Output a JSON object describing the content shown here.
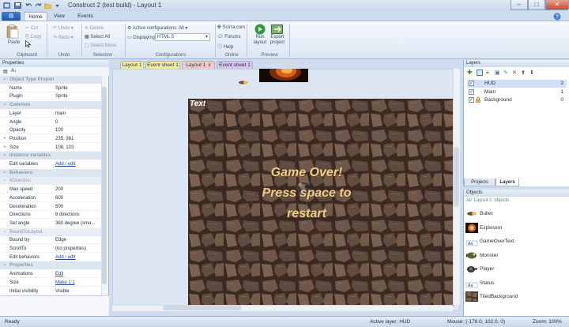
{
  "window": {
    "title": "Construct 2 (test build) - Layout 1",
    "app_menu_label": "▤"
  },
  "ribbon_tabs": [
    "Home",
    "View",
    "Events"
  ],
  "ribbon": {
    "clipboard": {
      "paste": "Paste",
      "cut": "Cut",
      "copy": "Copy",
      "group": "Clipboard"
    },
    "undo": {
      "undo": "Undo",
      "redo": "Redo",
      "group": "Undo"
    },
    "selection": {
      "delete": "Delete",
      "select_all": "Select All",
      "select_none": "Select None",
      "group": "Selection"
    },
    "configurations": {
      "active": "Active configurations: All",
      "displaying_label": "Displaying:",
      "displaying_value": "HTML 5",
      "group": "Configurations"
    },
    "online": {
      "scirra": "Scirra.com",
      "forums": "Forums",
      "help": "Help",
      "group": "Online"
    },
    "preview": {
      "run": "Run layout",
      "export": "Export project",
      "group": "Preview"
    }
  },
  "properties": {
    "header": "Properties",
    "rows": [
      {
        "kind": "cat",
        "key": "Object Type Properties"
      },
      {
        "kind": "row",
        "key": "Name",
        "value": "Sprite"
      },
      {
        "kind": "row",
        "key": "Plugin",
        "value": "Sprite"
      },
      {
        "kind": "cat",
        "key": "Common"
      },
      {
        "kind": "row",
        "key": "Layer",
        "value": "main"
      },
      {
        "kind": "row",
        "key": "Angle",
        "value": "0"
      },
      {
        "kind": "row",
        "key": "Opacity",
        "value": "100"
      },
      {
        "kind": "row",
        "key": "Position",
        "value": "235, 361",
        "expand": "+"
      },
      {
        "kind": "row",
        "key": "Size",
        "value": "108, 103",
        "expand": "+"
      },
      {
        "kind": "cat",
        "key": "Instance variables"
      },
      {
        "kind": "row",
        "key": "Edit variables",
        "value": "Add / edit",
        "link": true
      },
      {
        "kind": "cat",
        "key": "Behaviors"
      },
      {
        "kind": "sub",
        "key": "8Direction",
        "expand": "−"
      },
      {
        "kind": "row",
        "key": "Max speed",
        "value": "200"
      },
      {
        "kind": "row",
        "key": "Acceleration",
        "value": "600"
      },
      {
        "kind": "row",
        "key": "Deceleration",
        "value": "500"
      },
      {
        "kind": "row",
        "key": "Directions",
        "value": "8 directions"
      },
      {
        "kind": "row",
        "key": "Set angle",
        "value": "360 degree (smo..."
      },
      {
        "kind": "sub",
        "key": "BoundToLayout",
        "expand": "−"
      },
      {
        "kind": "row",
        "key": "Bound by",
        "value": "Edge"
      },
      {
        "kind": "row",
        "key": "ScrollTo",
        "value": "(no properties)"
      },
      {
        "kind": "row",
        "key": "Edit behaviors",
        "value": "Add / edit",
        "link": true
      },
      {
        "kind": "cat",
        "key": "Properties"
      },
      {
        "kind": "row",
        "key": "Animations",
        "value": "Edit",
        "link": true
      },
      {
        "kind": "row",
        "key": "Size",
        "value": "Make 1:1",
        "link": true
      },
      {
        "kind": "row",
        "key": "Initial visibility",
        "value": "Visible"
      }
    ]
  },
  "doc_tabs": [
    {
      "label": "Layout 1",
      "color": "#f3e9a6"
    },
    {
      "label": "Event sheet 1",
      "color": "#f3e9a6"
    },
    {
      "label": "Layout 1",
      "color": "#f2c9c9",
      "active": true,
      "close": "x"
    },
    {
      "label": "Event sheet 1",
      "color": "#d8c4ee"
    }
  ],
  "layout": {
    "text_object": "Text",
    "game_over_text": "Game Over!\nPress space to\nrestart"
  },
  "layers": {
    "header": "Layers",
    "rows": [
      {
        "name": "HUD",
        "num": "2",
        "selected": true
      },
      {
        "name": "Main",
        "num": "1"
      },
      {
        "name": "Background",
        "num": "0",
        "locked": true
      }
    ],
    "tabs": [
      "Projects",
      "Layers"
    ]
  },
  "objects": {
    "header": "Objects",
    "filter": "All 'Layout 1' objects",
    "items": [
      {
        "name": "Bullet",
        "icon": "bullet-icon"
      },
      {
        "name": "Explosion",
        "icon": "explosion-icon"
      },
      {
        "name": "GameOverText",
        "icon": "text-icon"
      },
      {
        "name": "Monster",
        "icon": "monster-icon"
      },
      {
        "name": "Player",
        "icon": "player-icon"
      },
      {
        "name": "Status",
        "icon": "text-icon"
      },
      {
        "name": "TiledBackground",
        "icon": "tiled-bg-icon"
      }
    ]
  },
  "status": {
    "left": "Ready",
    "active_layer": "Active layer: HUD",
    "mouse": "Mouse: (-178.0, 102.0, 0)",
    "zoom": "Zoom: 100%"
  }
}
